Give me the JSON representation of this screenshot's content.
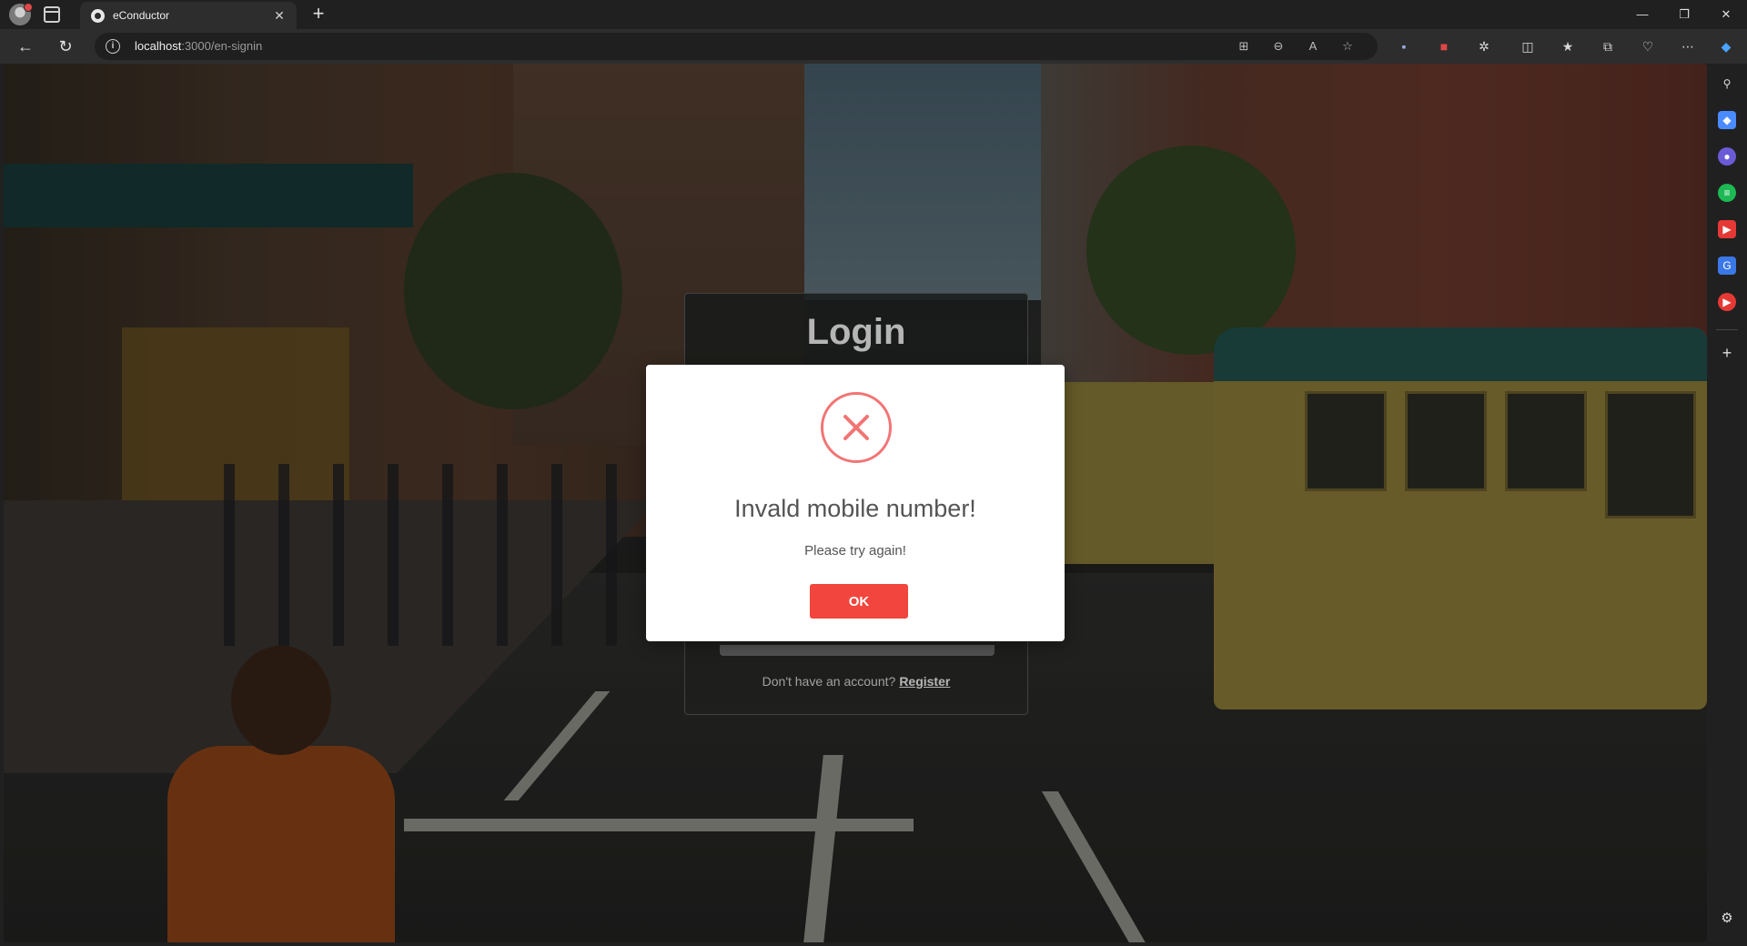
{
  "browser": {
    "tab_title": "eConductor",
    "tab_close": "✕",
    "new_tab": "+",
    "url_host": "localhost",
    "url_path": ":3000/en-signin",
    "window_controls": {
      "minimize": "—",
      "maximize": "❐",
      "close": "✕"
    },
    "icons": [
      "back-icon",
      "refresh-icon",
      "info-icon",
      "app-icon",
      "zoom-icon",
      "read-aloud-icon",
      "favorite-icon",
      "extensions-icon",
      "split-screen-icon",
      "favorites-icon",
      "collections-icon",
      "performance-icon",
      "more-icon",
      "copilot-icon"
    ]
  },
  "sidebar": {
    "icons": [
      "search-icon",
      "shopping-icon",
      "copilot-icon",
      "spotify-icon",
      "youtube-icon",
      "translate-icon",
      "music-icon",
      "add-icon",
      "settings-icon"
    ]
  },
  "login": {
    "title": "Login",
    "footer_text": "Don't have an account?",
    "register_link": "Register"
  },
  "modal": {
    "title": "Invald mobile number!",
    "text": "Please try again!",
    "ok_label": "OK",
    "accent": "#f27474",
    "button_color": "#f2453d"
  }
}
